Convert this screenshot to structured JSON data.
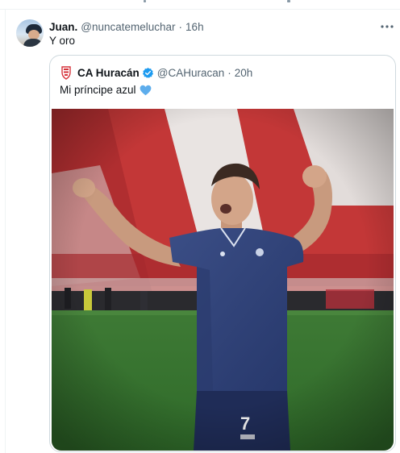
{
  "tweet": {
    "author_name": "Juan.",
    "author_handle": "@nuncatemeluchar",
    "separator": "·",
    "time": "16h",
    "text": "Y oro",
    "more_icon": "more-horizontal-icon"
  },
  "quoted_tweet": {
    "author_name": "CA Huracán",
    "author_handle": "@CAHuracan",
    "separator": "·",
    "time": "20h",
    "text": "Mi príncipe azul",
    "emoji": "blue-heart-icon",
    "verified": true,
    "logo_icon": "club-crest-icon",
    "photo": {
      "subject": "player-celebrating-photo",
      "shirt_number": "7"
    }
  },
  "colors": {
    "text_primary": "#0f1419",
    "text_secondary": "#536471",
    "verified_blue": "#1d9bf0",
    "heart_blue": "#5dadec",
    "card_border": "#cfd9de",
    "crest_red": "#d6333b"
  }
}
